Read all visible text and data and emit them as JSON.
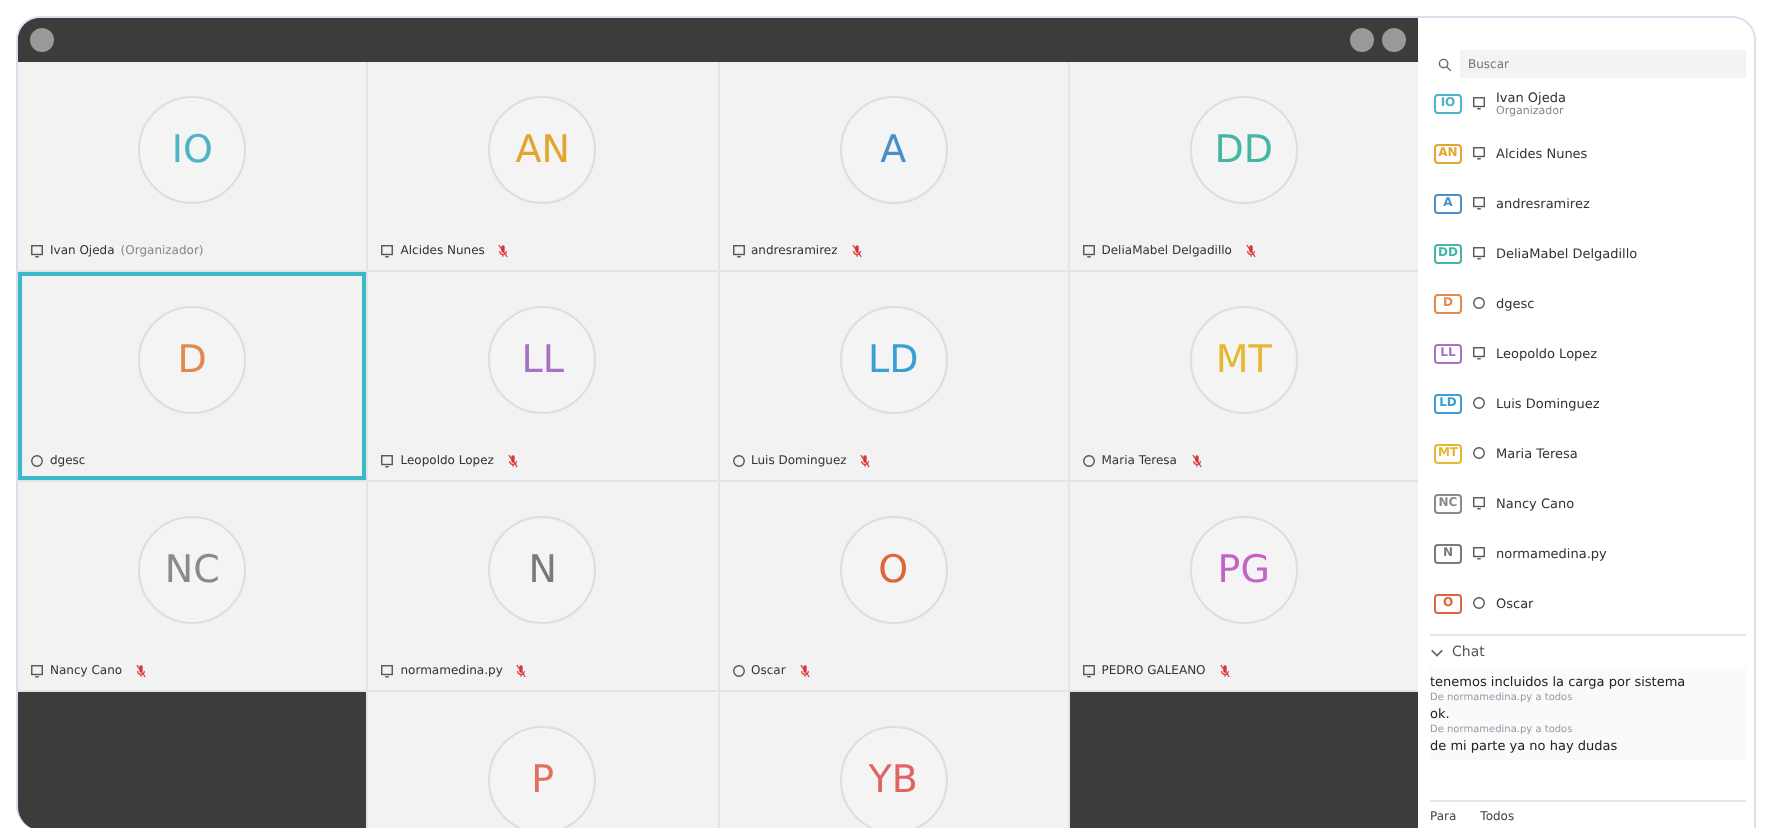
{
  "tiles": [
    {
      "kind": "person",
      "initials": "IO",
      "color": "#4fb3c8",
      "name": "Ivan Ojeda",
      "role": "(Organizador)",
      "web": false,
      "muted": false,
      "selected": false
    },
    {
      "kind": "person",
      "initials": "AN",
      "color": "#e2a531",
      "name": "Alcides Nunes",
      "web": false,
      "muted": true,
      "selected": false
    },
    {
      "kind": "person",
      "initials": "A",
      "color": "#4a8fcc",
      "name": "andresramirez",
      "web": false,
      "muted": true,
      "selected": false
    },
    {
      "kind": "person",
      "initials": "DD",
      "color": "#45b5a5",
      "name": "DeliaMabel Delgadillo",
      "web": false,
      "muted": true,
      "selected": false
    },
    {
      "kind": "person",
      "initials": "D",
      "color": "#e08a4f",
      "name": "dgesc",
      "web": true,
      "muted": false,
      "selected": true
    },
    {
      "kind": "person",
      "initials": "LL",
      "color": "#a673c4",
      "name": "Leopoldo Lopez",
      "web": false,
      "muted": true,
      "selected": false
    },
    {
      "kind": "person",
      "initials": "LD",
      "color": "#3a9fd2",
      "name": "Luis Dominguez",
      "web": true,
      "muted": true,
      "selected": false
    },
    {
      "kind": "person",
      "initials": "MT",
      "color": "#e6b832",
      "name": "Maria Teresa",
      "web": true,
      "muted": true,
      "selected": false
    },
    {
      "kind": "person",
      "initials": "NC",
      "color": "#8a8a8a",
      "name": "Nancy Cano",
      "web": false,
      "muted": true,
      "selected": false
    },
    {
      "kind": "person",
      "initials": "N",
      "color": "#7a7a7a",
      "name": "normamedina.py",
      "web": false,
      "muted": true,
      "selected": false
    },
    {
      "kind": "person",
      "initials": "O",
      "color": "#e0643e",
      "name": "Oscar",
      "web": true,
      "muted": true,
      "selected": false
    },
    {
      "kind": "person",
      "initials": "PG",
      "color": "#c463c6",
      "name": "PEDRO GALEANO",
      "web": false,
      "muted": true,
      "selected": false
    },
    {
      "kind": "empty"
    },
    {
      "kind": "person",
      "initials": "P",
      "color": "#e07060",
      "selected": false
    },
    {
      "kind": "person",
      "initials": "YB",
      "color": "#e06464",
      "selected": false
    },
    {
      "kind": "empty"
    }
  ],
  "search": {
    "placeholder": "Buscar"
  },
  "participants": [
    {
      "initials": "IO",
      "color": "#4fb3c8",
      "web": false,
      "name": "Ivan Ojeda",
      "subtitle": "Organizador"
    },
    {
      "initials": "AN",
      "color": "#e2a531",
      "web": false,
      "name": "Alcides Nunes"
    },
    {
      "initials": "A",
      "color": "#4a8fcc",
      "web": false,
      "name": "andresramirez"
    },
    {
      "initials": "DD",
      "color": "#45b5a5",
      "web": false,
      "name": "DeliaMabel Delgadillo"
    },
    {
      "initials": "D",
      "color": "#e08a4f",
      "web": true,
      "name": "dgesc"
    },
    {
      "initials": "LL",
      "color": "#a673c4",
      "web": false,
      "name": "Leopoldo Lopez"
    },
    {
      "initials": "LD",
      "color": "#3a9fd2",
      "web": true,
      "name": "Luis Dominguez"
    },
    {
      "initials": "MT",
      "color": "#e6b832",
      "web": true,
      "name": "Maria Teresa"
    },
    {
      "initials": "NC",
      "color": "#8a8a8a",
      "web": false,
      "name": "Nancy Cano"
    },
    {
      "initials": "N",
      "color": "#7a7a7a",
      "web": false,
      "name": "normamedina.py"
    },
    {
      "initials": "O",
      "color": "#e0643e",
      "web": true,
      "name": "Oscar"
    }
  ],
  "chat": {
    "title": "Chat",
    "expanded": true,
    "messages": [
      {
        "text": "tenemos incluidos la carga por sistema",
        "meta": "De normamedina.py a todos"
      },
      {
        "text": "ok.",
        "meta": "De normamedina.py a todos"
      },
      {
        "text": "de mi parte ya no hay dudas"
      }
    ],
    "to_label": "Para",
    "to_value": "Todos"
  }
}
